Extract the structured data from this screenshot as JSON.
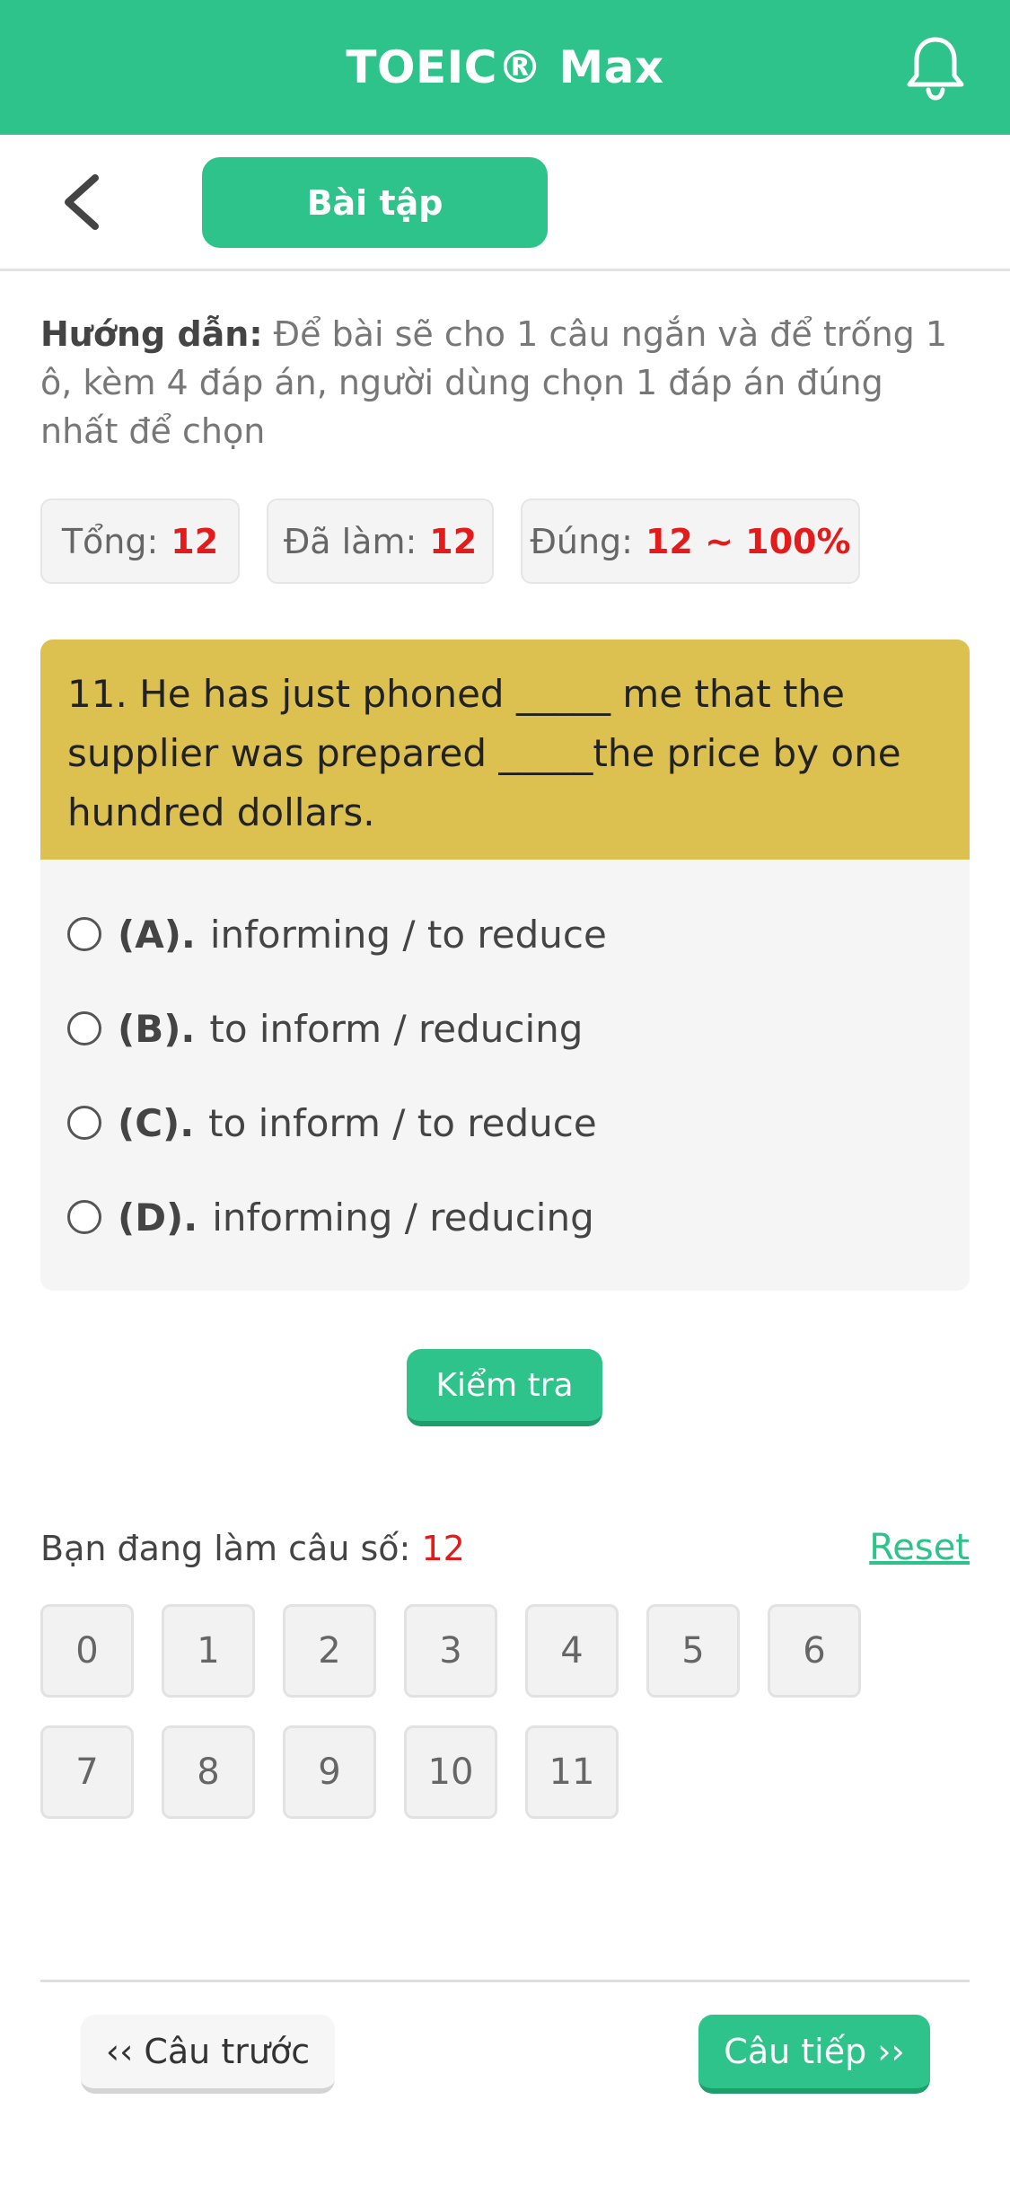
{
  "header": {
    "title": "TOEIC® Max",
    "notification_icon": "bell-icon"
  },
  "toolbar": {
    "back_icon": "chevron-left-icon",
    "tab_label": "Bài tập"
  },
  "instruction": {
    "label": "Hướng dẫn:",
    "text": " Để bài sẽ cho 1 câu ngắn và để trống 1 ô, kèm 4 đáp án, người dùng chọn 1 đáp án đúng nhất để chọn"
  },
  "stats": {
    "total_label": "Tổng:",
    "total_value": "12",
    "done_label": "Đã làm:",
    "done_value": "12",
    "correct_label": "Đúng:",
    "correct_value": "12 ~ 100%"
  },
  "question": {
    "text": "11. He has just phoned _____ me that the supplier was prepared _____the price by one hundred dollars.",
    "options": [
      {
        "letter": "(A).",
        "text": "informing / to reduce"
      },
      {
        "letter": "(B).",
        "text": "to inform / reducing"
      },
      {
        "letter": "(C).",
        "text": "to inform / to reduce"
      },
      {
        "letter": "(D).",
        "text": "informing / reducing"
      }
    ]
  },
  "check_button": "Kiểm tra",
  "progress": {
    "label": "Bạn đang làm câu số:",
    "current": "12",
    "reset_label": "Reset",
    "numbers": [
      "0",
      "1",
      "2",
      "3",
      "4",
      "5",
      "6",
      "7",
      "8",
      "9",
      "10",
      "11"
    ]
  },
  "footer": {
    "prev_label": "‹‹ Câu trước",
    "next_label": "Câu tiếp ››"
  },
  "colors": {
    "brand": "#2ec38a",
    "question_bg": "#dcc150",
    "highlight": "#e31b1b"
  }
}
